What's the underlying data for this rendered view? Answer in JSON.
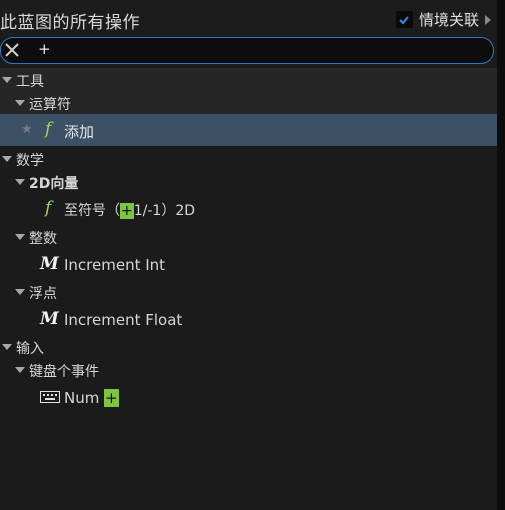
{
  "header": {
    "title": "此蓝图的所有操作",
    "context_label": "情境关联",
    "context_checked": true
  },
  "search": {
    "value": "+"
  },
  "tree": {
    "tools": "工具",
    "operators": "运算符",
    "add": "添加",
    "math": "数学",
    "vector2d": "2D向量",
    "sign_prefix": "至符号（",
    "sign_highlight": "+",
    "sign_suffix": "1/-1）2D",
    "integer": "整数",
    "increment_int": "Increment Int",
    "float": "浮点",
    "increment_float": "Increment Float",
    "input": "输入",
    "keyboard_events": "键盘个事件",
    "num_prefix": "Num ",
    "num_highlight": "+"
  },
  "icons": {
    "function": "f",
    "macro": "M"
  }
}
